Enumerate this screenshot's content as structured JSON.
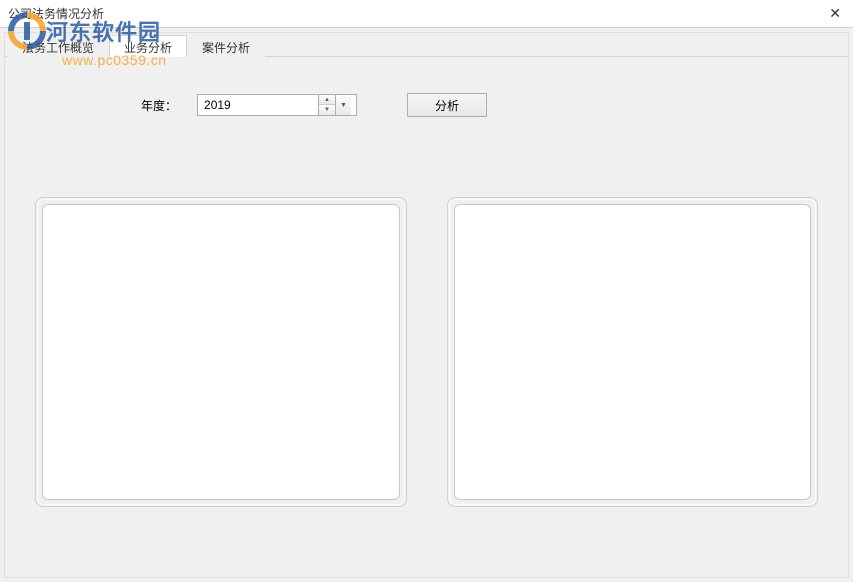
{
  "window": {
    "title": "公司法务情况分析",
    "close_label": "✕"
  },
  "watermark": {
    "main_text": "河东软件园",
    "sub_text": "www.pc0359.cn"
  },
  "tabs": [
    {
      "label": "法务工作概览",
      "active": false
    },
    {
      "label": "业务分析",
      "active": true
    },
    {
      "label": "案件分析",
      "active": false
    }
  ],
  "controls": {
    "year_label": "年度：",
    "year_value": "2019",
    "analyze_label": "分析"
  }
}
